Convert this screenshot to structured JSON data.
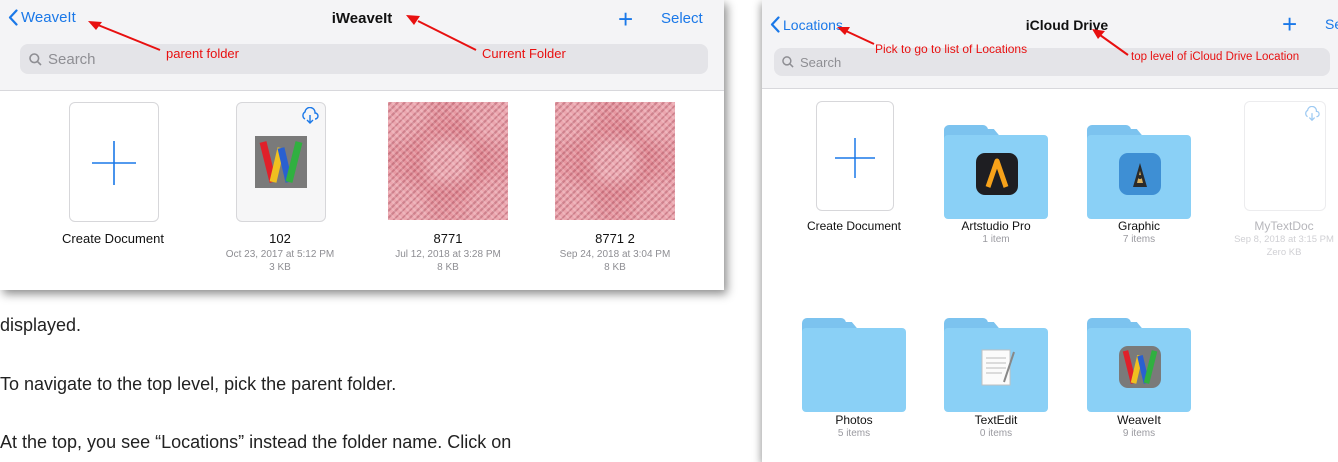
{
  "left": {
    "back_label": "WeaveIt",
    "title": "iWeaveIt",
    "plus_label": "+",
    "select_label": "Select",
    "search_placeholder": "Search",
    "annotations": {
      "parent": "parent folder",
      "current": "Current Folder"
    },
    "items": [
      {
        "name": "Create Document"
      },
      {
        "name": "102",
        "date": "Oct 23, 2017 at 5:12 PM",
        "size": "3 KB"
      },
      {
        "name": "8771",
        "date": "Jul 12, 2018 at 3:28 PM",
        "size": "8 KB"
      },
      {
        "name": "8771 2",
        "date": "Sep 24, 2018 at 3:04 PM",
        "size": "8 KB"
      }
    ]
  },
  "body_text": [
    "displayed.",
    "To navigate to the top level, pick the parent folder.",
    "At the top, you see  “Locations” instead the folder name.  Click on"
  ],
  "right": {
    "back_label": "Locations",
    "title": "iCloud Drive",
    "plus_label": "+",
    "select_label": "Se",
    "search_placeholder": "Search",
    "annotations": {
      "locations": "Pick to go to list of Locations",
      "top": "top level of iCloud Drive Location"
    },
    "items": [
      {
        "name": "Create Document"
      },
      {
        "name": "Artstudio Pro",
        "count": "1 item"
      },
      {
        "name": "Graphic",
        "count": "7 items"
      },
      {
        "name": "MyTextDoc",
        "date": "Sep 8, 2018 at 3:15 PM",
        "size": "Zero KB"
      },
      {
        "name": "Photos",
        "count": "5 items"
      },
      {
        "name": "TextEdit",
        "count": "0 items"
      },
      {
        "name": "WeaveIt",
        "count": "9 items"
      }
    ]
  },
  "colors": {
    "accent": "#1a78e8",
    "annotation": "#e81010",
    "folder": "#8ad0f6"
  }
}
